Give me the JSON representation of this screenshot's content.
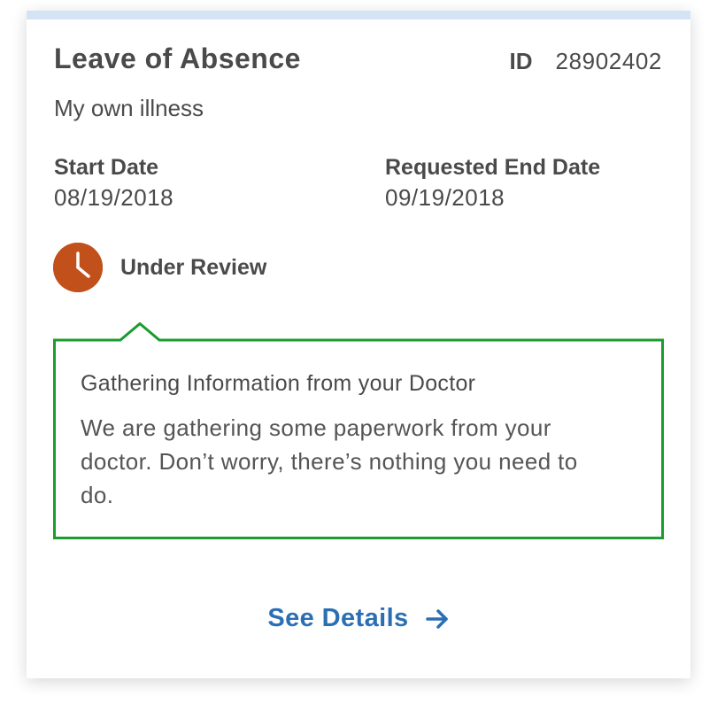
{
  "card": {
    "title": "Leave of Absence",
    "id_label": "ID",
    "id_value": "28902402",
    "reason": "My own illness",
    "start_date_label": "Start Date",
    "start_date_value": "08/19/2018",
    "end_date_label": "Requested End Date",
    "end_date_value": "09/19/2018",
    "status": {
      "label": "Under Review",
      "icon": "clock-icon",
      "color": "#c1501b"
    },
    "callout": {
      "title": "Gathering Information from your Doctor",
      "body": "We are gathering some paperwork from your doctor. Don’t worry, there’s nothing you need to do.",
      "border_color": "#1a9c2e"
    },
    "action": {
      "label": "See Details",
      "icon": "arrow-right-icon",
      "color": "#2a6fb3"
    },
    "accent_color": "#d4e4f5"
  }
}
